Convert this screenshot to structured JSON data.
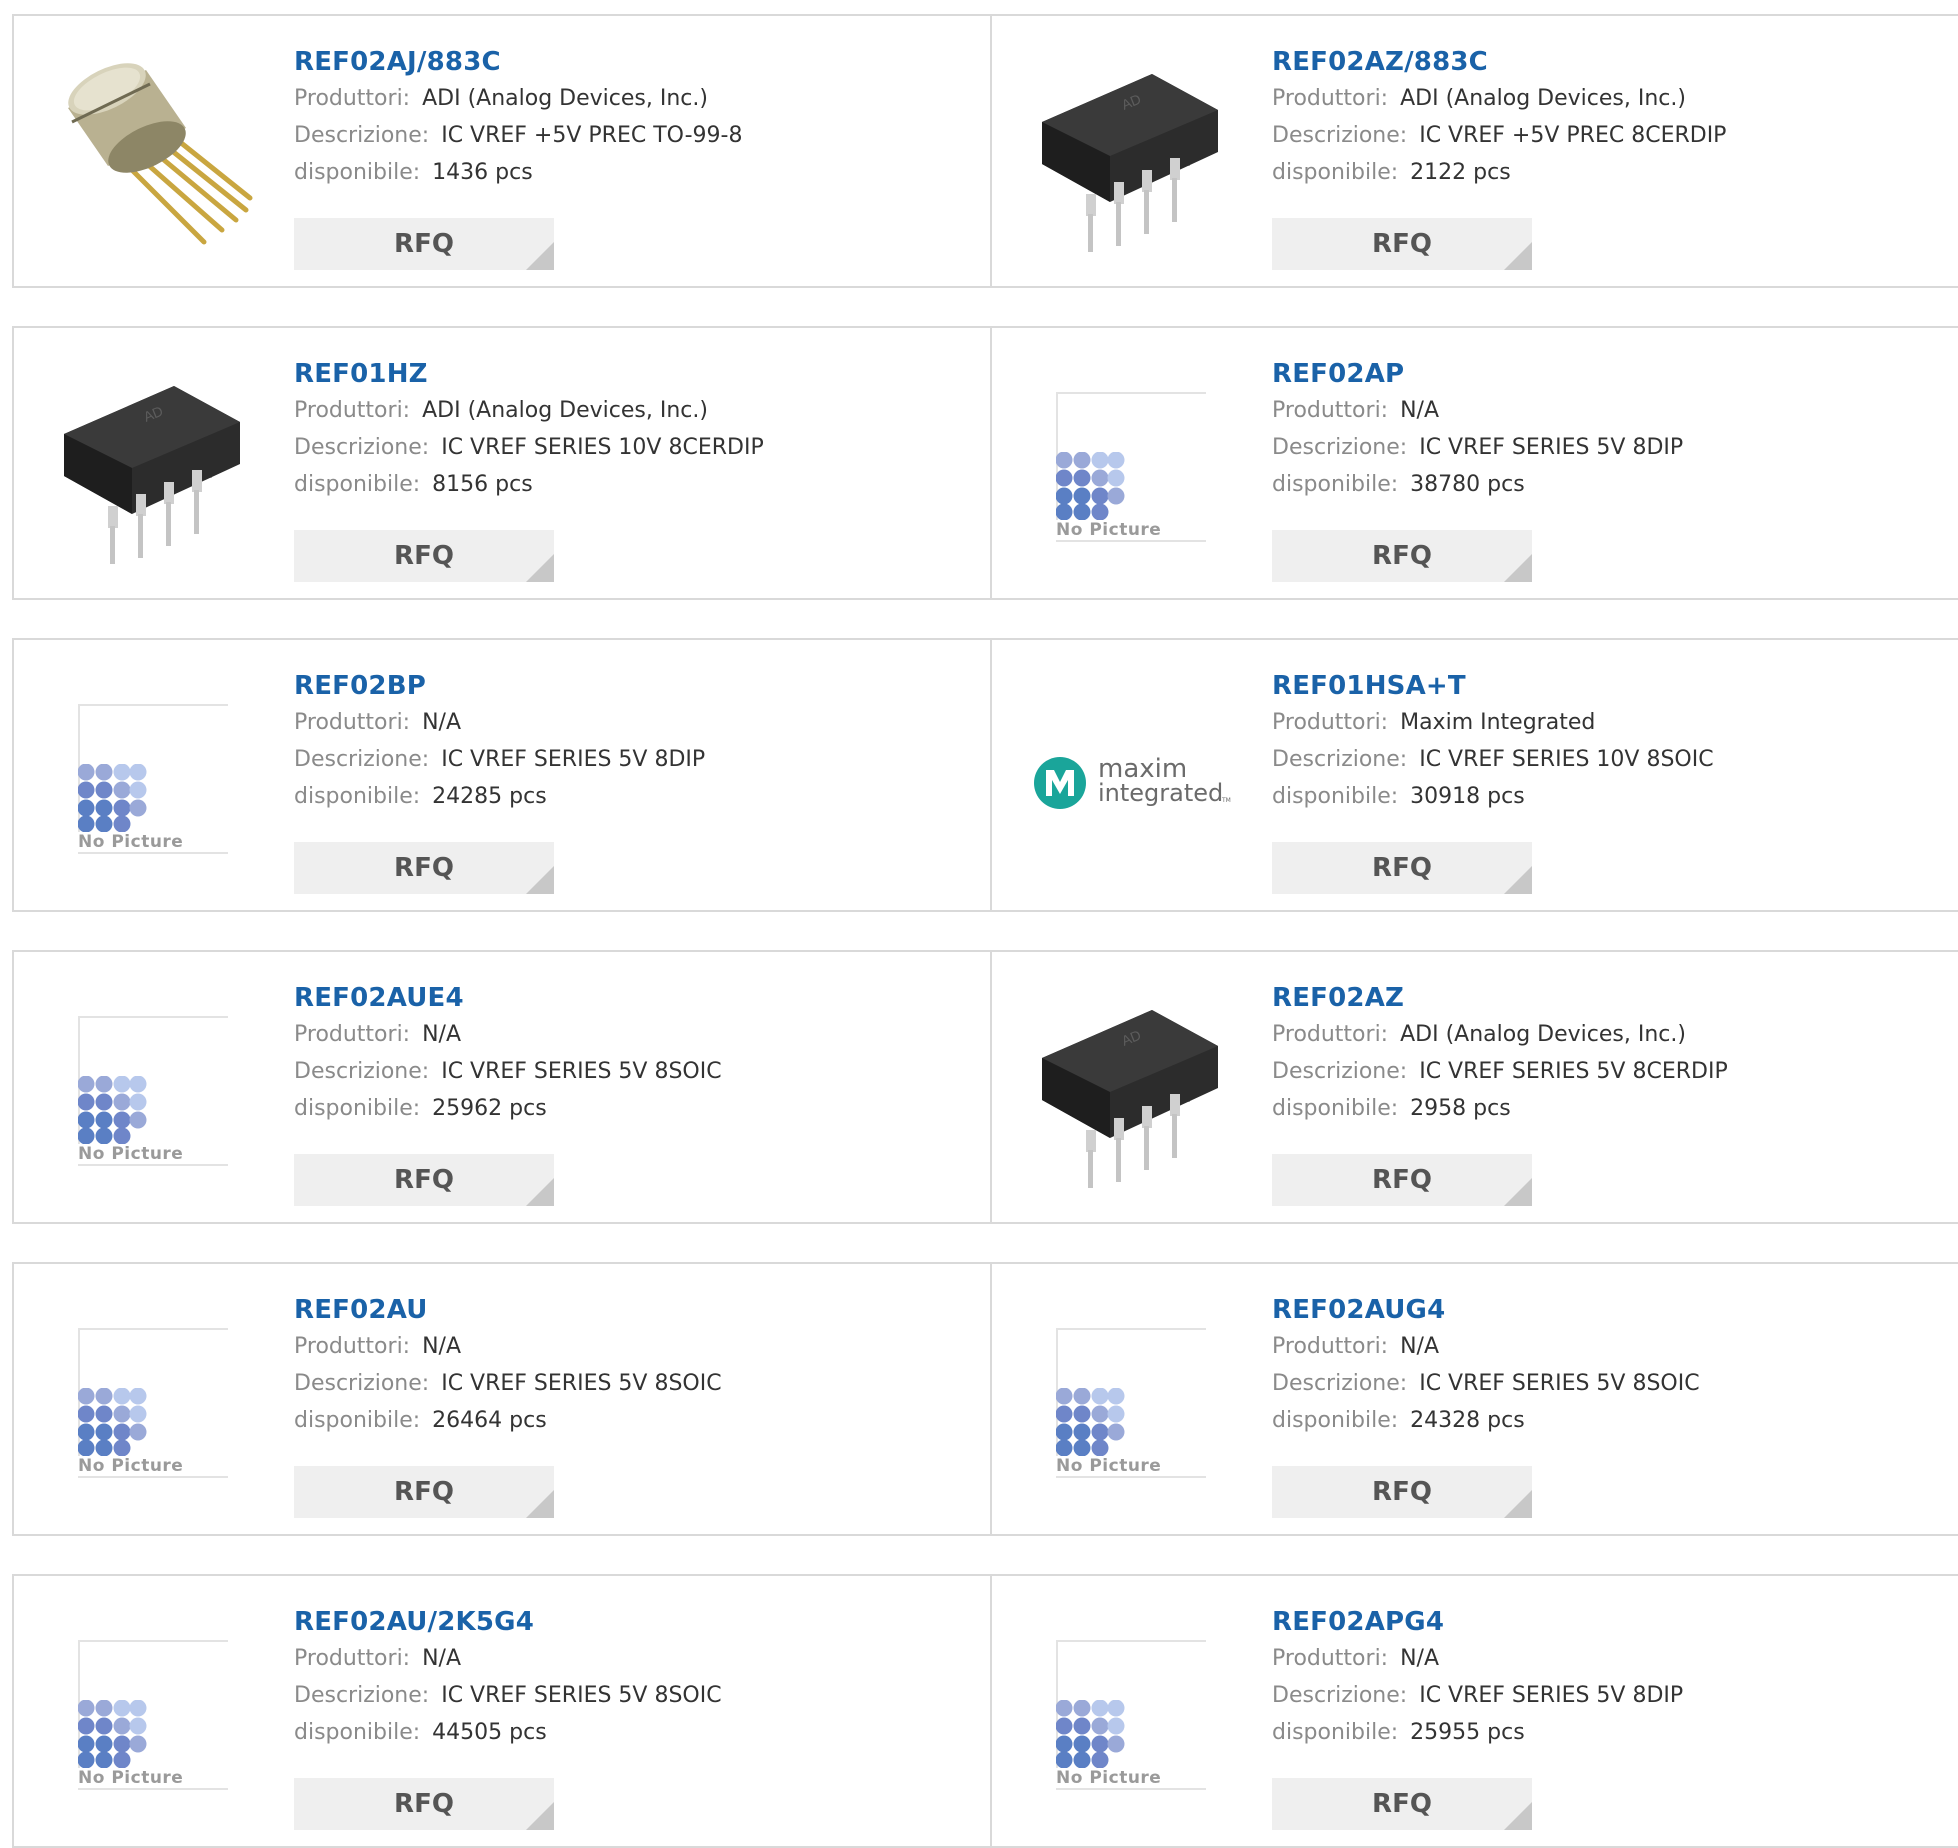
{
  "labels": {
    "manufacturer": "Produttori:",
    "description": "Descrizione:",
    "available": "disponibile:",
    "rfq": "RFQ",
    "no_picture": "No Picture"
  },
  "products": [
    {
      "part": "REF02AJ/883C",
      "manufacturer": "ADI (Analog Devices, Inc.)",
      "description": "IC VREF +5V PREC TO-99-8",
      "available": "1436 pcs",
      "image": "to99-can"
    },
    {
      "part": "REF02AZ/883C",
      "manufacturer": "ADI (Analog Devices, Inc.)",
      "description": "IC VREF +5V PREC 8CERDIP",
      "available": "2122 pcs",
      "image": "dip8-chip"
    },
    {
      "part": "REF01HZ",
      "manufacturer": "ADI (Analog Devices, Inc.)",
      "description": "IC VREF SERIES 10V 8CERDIP",
      "available": "8156 pcs",
      "image": "dip8-chip"
    },
    {
      "part": "REF02AP",
      "manufacturer": "N/A",
      "description": "IC VREF SERIES 5V 8DIP",
      "available": "38780 pcs",
      "image": "no-picture"
    },
    {
      "part": "REF02BP",
      "manufacturer": "N/A",
      "description": "IC VREF SERIES 5V 8DIP",
      "available": "24285 pcs",
      "image": "no-picture"
    },
    {
      "part": "REF01HSA+T",
      "manufacturer": "Maxim Integrated",
      "description": "IC VREF SERIES 10V 8SOIC",
      "available": "30918 pcs",
      "image": "maxim-logo"
    },
    {
      "part": "REF02AUE4",
      "manufacturer": "N/A",
      "description": "IC VREF SERIES 5V 8SOIC",
      "available": "25962 pcs",
      "image": "no-picture"
    },
    {
      "part": "REF02AZ",
      "manufacturer": "ADI (Analog Devices, Inc.)",
      "description": "IC VREF SERIES 5V 8CERDIP",
      "available": "2958 pcs",
      "image": "dip8-chip"
    },
    {
      "part": "REF02AU",
      "manufacturer": "N/A",
      "description": "IC VREF SERIES 5V 8SOIC",
      "available": "26464 pcs",
      "image": "no-picture"
    },
    {
      "part": "REF02AUG4",
      "manufacturer": "N/A",
      "description": "IC VREF SERIES 5V 8SOIC",
      "available": "24328 pcs",
      "image": "no-picture"
    },
    {
      "part": "REF02AU/2K5G4",
      "manufacturer": "N/A",
      "description": "IC VREF SERIES 5V 8SOIC",
      "available": "44505 pcs",
      "image": "no-picture"
    },
    {
      "part": "REF02APG4",
      "manufacturer": "N/A",
      "description": "IC VREF SERIES 5V 8DIP",
      "available": "25955 pcs",
      "image": "no-picture"
    }
  ],
  "maxim_logo": {
    "line1": "maxim",
    "line2": "integrated",
    "tm": "TM"
  },
  "chip_marking": "AD",
  "colors": {
    "link": "#1a62a8",
    "border": "#d9d9d9",
    "button_bg": "#efefef",
    "maxim_teal": "#1aa59a",
    "dots": [
      "#5a7fc4",
      "#6f86c9",
      "#9aa9d8",
      "#b7c8ec"
    ]
  }
}
